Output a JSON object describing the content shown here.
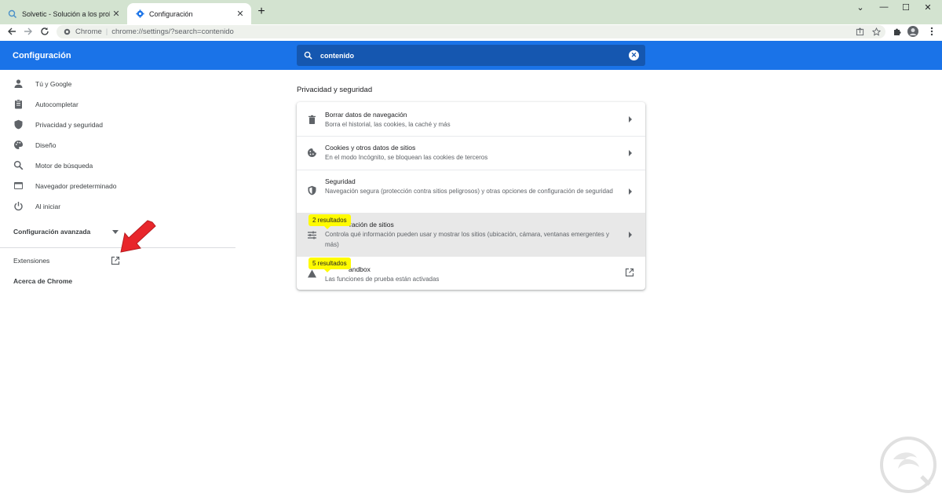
{
  "browser": {
    "tabs": [
      {
        "title": "Solvetic - Solución a los problem",
        "icon": "solvetic-favicon-icon"
      },
      {
        "title": "Configuración",
        "icon": "gear-icon"
      }
    ],
    "omnibox": {
      "site": "Chrome",
      "url": "chrome://settings/?search=contenido"
    }
  },
  "header": {
    "title": "Configuración",
    "search_value": "contenido"
  },
  "sidebar": {
    "items": [
      {
        "label": "Tú y Google",
        "icon": "person-icon"
      },
      {
        "label": "Autocompletar",
        "icon": "clipboard-icon"
      },
      {
        "label": "Privacidad y seguridad",
        "icon": "shield-icon"
      },
      {
        "label": "Diseño",
        "icon": "palette-icon"
      },
      {
        "label": "Motor de búsqueda",
        "icon": "search-icon"
      },
      {
        "label": "Navegador predeterminado",
        "icon": "browser-icon"
      },
      {
        "label": "Al iniciar",
        "icon": "power-icon"
      }
    ],
    "advanced": "Configuración avanzada",
    "extensions": "Extensiones",
    "about": "Acerca de Chrome"
  },
  "main": {
    "section_title": "Privacidad y seguridad",
    "rows": [
      {
        "title": "Borrar datos de navegación",
        "subtitle": "Borra el historial, las cookies, la caché y más",
        "icon": "trash-icon"
      },
      {
        "title": "Cookies y otros datos de sitios",
        "subtitle": "En el modo Incógnito, se bloquean las cookies de terceros",
        "icon": "cookie-icon"
      },
      {
        "title": "Seguridad",
        "subtitle": "Navegación segura (protección contra sitios peligrosos) y otras opciones de configuración de seguridad",
        "icon": "shield-icon"
      },
      {
        "title": "ración de sitios",
        "subtitle": "Controla qué información pueden usar y mostrar los sitios (ubicación, cámara, ventanas emergentes y más)",
        "icon": "tune-icon",
        "badge": "2 resultados"
      },
      {
        "title": "andbox",
        "subtitle": "Las funciones de prueba están activadas",
        "icon": "flask-icon",
        "badge": "5 resultados"
      }
    ]
  },
  "colors": {
    "accent": "#1a73e8",
    "highlight": "#fffb00",
    "arrow": "#e8262b"
  }
}
